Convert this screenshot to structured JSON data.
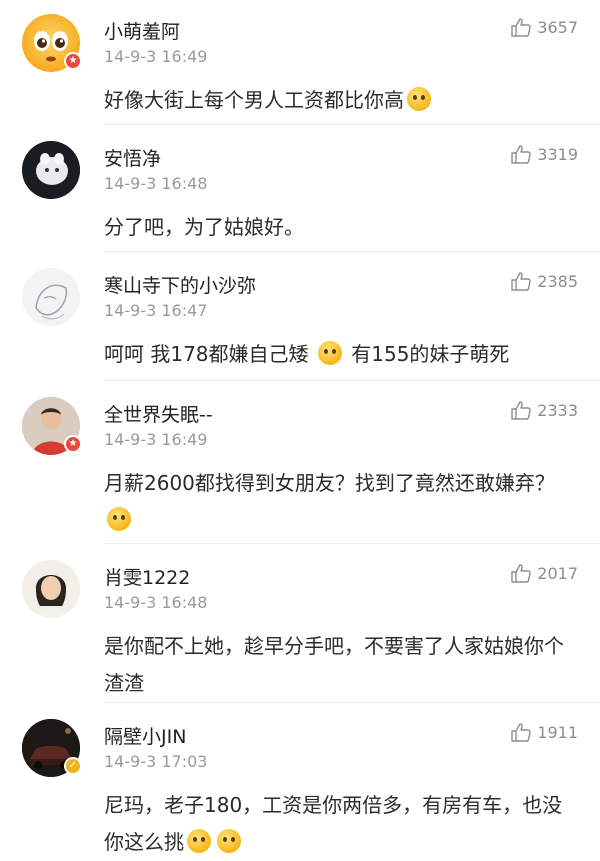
{
  "comments": [
    {
      "username": "小萌羞阿",
      "time": "14-9-3 16:49",
      "likes": "3657",
      "text": "好像大街上每个男人工资都比你高",
      "avatar": "sad-face-emoji-icon",
      "badge": "red-star-badge"
    },
    {
      "username": "安悟净",
      "time": "14-9-3 16:48",
      "likes": "3319",
      "text": "分了吧，为了姑娘好。",
      "avatar": "white-cat-photo"
    },
    {
      "username": "寒山寺下的小沙弥",
      "time": "14-9-3 16:47",
      "likes": "2385",
      "text_a": "呵呵 我178都嫌自己矮",
      "text_b": "有155的妹子萌死",
      "avatar": "sketch-portrait"
    },
    {
      "username": "全世界失眠--",
      "time": "14-9-3 16:49",
      "likes": "2333",
      "text": "月薪2600都找得到女朋友？找到了竟然还敢嫌弃？",
      "avatar": "person-in-red-shirt",
      "badge": "red-star-badge"
    },
    {
      "username": "肖雯1222",
      "time": "14-9-3 16:48",
      "likes": "2017",
      "text": "是你配不上她，趁早分手吧，不要害了人家姑娘你个渣渣",
      "avatar": "woman-portrait"
    },
    {
      "username": "隔壁小JIN",
      "time": "14-9-3 17:03",
      "likes": "1911",
      "text": "尼玛，老子180，工资是你两倍多，有房有车，也没你这么挑",
      "avatar": "dark-car-photo",
      "badge": "gold-v-badge"
    }
  ]
}
